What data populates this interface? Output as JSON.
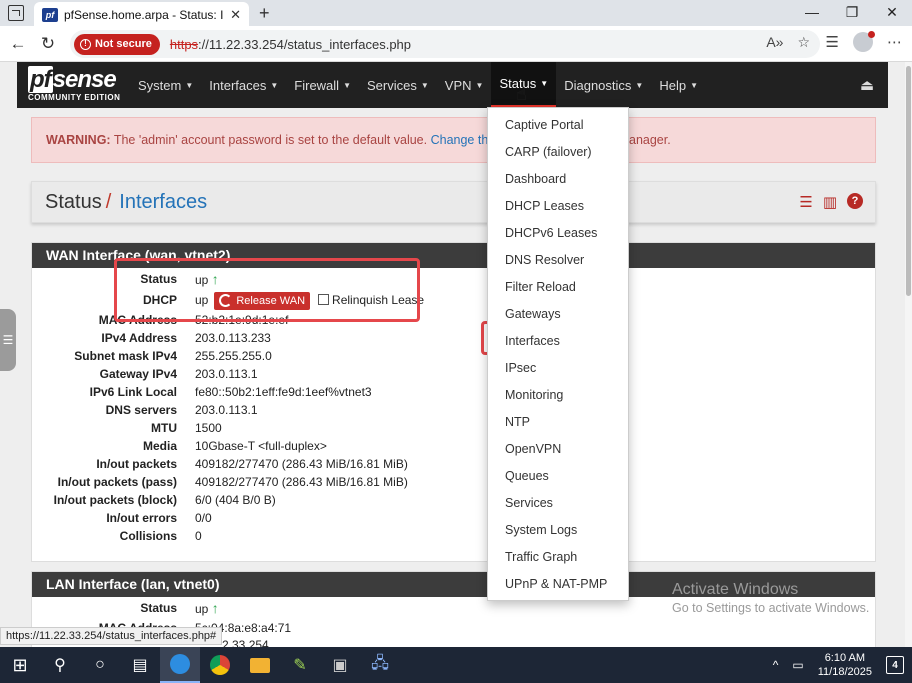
{
  "browser": {
    "tab_title": "pfSense.home.arpa - Status: Interf",
    "tab_favicon": "pf",
    "new_tab": "+",
    "not_secure": "Not secure",
    "url_scheme": "https",
    "url_rest": "://11.22.33.254/status_interfaces.php",
    "status_url": "https://11.22.33.254/status_interfaces.php#"
  },
  "logo": {
    "brand_pf": "pf",
    "brand_rest": "sense",
    "edition": "COMMUNITY EDITION"
  },
  "nav": {
    "items": [
      {
        "label": "System"
      },
      {
        "label": "Interfaces"
      },
      {
        "label": "Firewall"
      },
      {
        "label": "Services"
      },
      {
        "label": "VPN"
      },
      {
        "label": "Status"
      },
      {
        "label": "Diagnostics"
      },
      {
        "label": "Help"
      }
    ]
  },
  "warning": {
    "bold": "WARNING:",
    "text": " The 'admin' account password is set to the default value. ",
    "link": "Change the",
    "tail": "anager."
  },
  "breadcrumb": {
    "section": "Status",
    "sep": "/",
    "page": "Interfaces"
  },
  "wan": {
    "header": "WAN Interface (wan, vtnet2)",
    "rows": [
      {
        "k": "Status",
        "v": "up"
      },
      {
        "k": "DHCP",
        "v": "up"
      },
      {
        "k": "MAC Address",
        "v": "52:b2:1e:9d:1e:ef"
      },
      {
        "k": "IPv4 Address",
        "v": "203.0.113.233"
      },
      {
        "k": "Subnet mask IPv4",
        "v": "255.255.255.0"
      },
      {
        "k": "Gateway IPv4",
        "v": "203.0.113.1"
      },
      {
        "k": "IPv6 Link Local",
        "v": "fe80::50b2:1eff:fe9d:1eef%vtnet3"
      },
      {
        "k": "DNS servers",
        "v": "203.0.113.1"
      },
      {
        "k": "MTU",
        "v": "1500"
      },
      {
        "k": "Media",
        "v": "10Gbase-T <full-duplex>"
      },
      {
        "k": "In/out packets",
        "v": "409182/277470 (286.43 MiB/16.81 MiB)"
      },
      {
        "k": "In/out packets (pass)",
        "v": "409182/277470 (286.43 MiB/16.81 MiB)"
      },
      {
        "k": "In/out packets (block)",
        "v": "6/0 (404 B/0 B)"
      },
      {
        "k": "In/out errors",
        "v": "0/0"
      },
      {
        "k": "Collisions",
        "v": "0"
      }
    ],
    "release_label": "Release WAN",
    "relinquish_label": "Relinquish Lease"
  },
  "lan": {
    "header": "LAN Interface (lan, vtnet0)",
    "rows": [
      {
        "k": "Status",
        "v": "up"
      },
      {
        "k": "MAC Address",
        "v": "5c:04:8a:e8:a4:71"
      },
      {
        "k": "",
        "v": "2.33.254"
      }
    ]
  },
  "status_menu": {
    "items": [
      "Captive Portal",
      "CARP (failover)",
      "Dashboard",
      "DHCP Leases",
      "DHCPv6 Leases",
      "DNS Resolver",
      "Filter Reload",
      "Gateways",
      "Interfaces",
      "IPsec",
      "Monitoring",
      "NTP",
      "OpenVPN",
      "Queues",
      "Services",
      "System Logs",
      "Traffic Graph",
      "UPnP & NAT-PMP"
    ]
  },
  "watermark": {
    "line1": "Activate Windows",
    "line2": "Go to Settings to activate Windows."
  },
  "taskbar": {
    "time": "6:10 AM",
    "date": "11/18/2025",
    "notifications": "4"
  },
  "colors": {
    "accent_red": "#e5332a",
    "highlight_box": "#e5474b",
    "link_blue": "#2473b8",
    "up_green": "#2ea44f"
  }
}
